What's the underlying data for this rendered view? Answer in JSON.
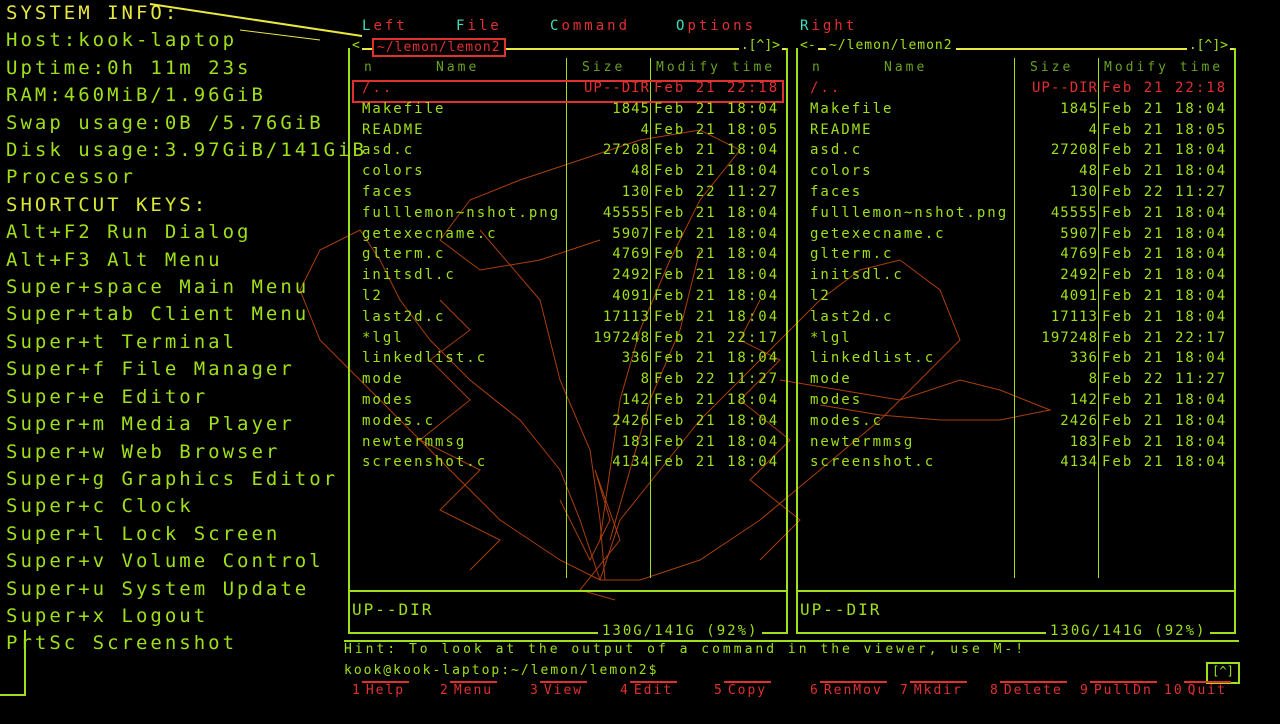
{
  "sysinfo": {
    "title": "SYSTEM INFO:",
    "host": "Host:kook-laptop",
    "uptime": "Uptime:0h 11m 23s",
    "ram": "RAM:460MiB/1.96GiB",
    "swap": "Swap usage:0B  /5.76GiB",
    "disk": "Disk usage:3.97GiB/141GiB",
    "processor": "Processor",
    "shortcut_title": "SHORTCUT KEYS:",
    "shortcuts": [
      "Alt+F2 Run Dialog",
      "Alt+F3 Alt Menu",
      "Super+space Main Menu",
      "Super+tab Client Menu",
      "Super+t Terminal",
      "Super+f File Manager",
      "Super+e Editor",
      "Super+m Media Player",
      "Super+w Web Browser",
      "Super+g Graphics Editor",
      "Super+c Clock",
      "Super+l Lock Screen",
      "Super+v Volume Control",
      "Super+u System Update",
      "Super+x Logout",
      "PrtSc Screenshot"
    ]
  },
  "menubar": {
    "left": {
      "hot": "L",
      "rest": "eft"
    },
    "file": {
      "hot": "F",
      "rest": "ile"
    },
    "command": {
      "hot": "C",
      "rest": "ommand"
    },
    "options": {
      "hot": "O",
      "rest": "ptions"
    },
    "right": {
      "hot": "R",
      "rest": "ight"
    }
  },
  "panel_left": {
    "path": "~/lemon/lemon2",
    "arrows": ".[^]>",
    "open": "<",
    "col_n": "n",
    "col_name": "Name",
    "col_size": "Size",
    "col_time": "Modify time",
    "mini_status": "UP--DIR",
    "free": "130G/141G (92%)"
  },
  "panel_right": {
    "path": "~/lemon/lemon2",
    "arrows": ".[^]>",
    "open": "<-",
    "col_n": "n",
    "col_name": "Name",
    "col_size": "Size",
    "col_time": "Modify time",
    "mini_status": "UP--DIR",
    "free": "130G/141G (92%)"
  },
  "files": [
    {
      "name": "/..",
      "size": "UP--DIR",
      "time": "Feb 21 22:18"
    },
    {
      "name": "Makefile",
      "size": "1845",
      "time": "Feb 21 18:04"
    },
    {
      "name": "README",
      "size": "4",
      "time": "Feb 21 18:05"
    },
    {
      "name": "asd.c",
      "size": "27208",
      "time": "Feb 21 18:04"
    },
    {
      "name": "colors",
      "size": "48",
      "time": "Feb 21 18:04"
    },
    {
      "name": "faces",
      "size": "130",
      "time": "Feb 22 11:27"
    },
    {
      "name": "fulllemon~nshot.png",
      "size": "45555",
      "time": "Feb 21 18:04"
    },
    {
      "name": "getexecname.c",
      "size": "5907",
      "time": "Feb 21 18:04"
    },
    {
      "name": "glterm.c",
      "size": "4769",
      "time": "Feb 21 18:04"
    },
    {
      "name": "initsdl.c",
      "size": "2492",
      "time": "Feb 21 18:04"
    },
    {
      "name": "l2",
      "size": "4091",
      "time": "Feb 21 18:04"
    },
    {
      "name": "last2d.c",
      "size": "17113",
      "time": "Feb 21 18:04"
    },
    {
      "name": "*lgl",
      "size": "197248",
      "time": "Feb 21 22:17"
    },
    {
      "name": "linkedlist.c",
      "size": "336",
      "time": "Feb 21 18:04"
    },
    {
      "name": "mode",
      "size": "8",
      "time": "Feb 22 11:27"
    },
    {
      "name": "modes",
      "size": "142",
      "time": "Feb 21 18:04"
    },
    {
      "name": "modes.c",
      "size": "2426",
      "time": "Feb 21 18:04"
    },
    {
      "name": "newtermmsg",
      "size": "183",
      "time": "Feb 21 18:04"
    },
    {
      "name": "screenshot.c",
      "size": "4134",
      "time": "Feb 21 18:04"
    }
  ],
  "hint": "Hint: To look at the output of a command in the viewer, use M-!",
  "prompt": "kook@kook-laptop:~/lemon/lemon2$",
  "scroll_btn": "[^]",
  "fkeys": [
    {
      "num": "1",
      "label": "Help"
    },
    {
      "num": "2",
      "label": "Menu"
    },
    {
      "num": "3",
      "label": "View"
    },
    {
      "num": "4",
      "label": "Edit"
    },
    {
      "num": "5",
      "label": "Copy"
    },
    {
      "num": "6",
      "label": "RenMov"
    },
    {
      "num": "7",
      "label": "Mkdir"
    },
    {
      "num": "8",
      "label": "Delete"
    },
    {
      "num": "9",
      "label": "PullDn"
    },
    {
      "num": "10",
      "label": "Quit"
    }
  ],
  "colors": {
    "text": "#9fe01a",
    "highlight": "#e03030",
    "hotkey": "#40e0c0",
    "title": "#e8e840"
  }
}
